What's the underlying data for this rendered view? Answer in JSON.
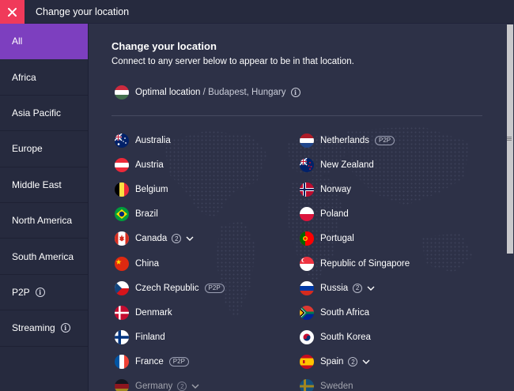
{
  "window": {
    "title": "Change your location"
  },
  "sidebar": {
    "items": [
      {
        "label": "All",
        "active": true
      },
      {
        "label": "Africa"
      },
      {
        "label": "Asia Pacific"
      },
      {
        "label": "Europe"
      },
      {
        "label": "Middle East"
      },
      {
        "label": "North America"
      },
      {
        "label": "South America"
      },
      {
        "label": "P2P",
        "info": true
      },
      {
        "label": "Streaming",
        "info": true
      }
    ]
  },
  "main": {
    "heading": "Change your location",
    "subheading": "Connect to any server below to appear to be in that location.",
    "optimal": {
      "label": "Optimal location",
      "separator": " / ",
      "place": "Budapest, Hungary",
      "flag": "hungary"
    }
  },
  "countries_left": [
    {
      "name": "Australia",
      "flag": "australia"
    },
    {
      "name": "Austria",
      "flag": "austria"
    },
    {
      "name": "Belgium",
      "flag": "belgium"
    },
    {
      "name": "Brazil",
      "flag": "brazil"
    },
    {
      "name": "Canada",
      "flag": "canada",
      "count": "2"
    },
    {
      "name": "China",
      "flag": "china"
    },
    {
      "name": "Czech Republic",
      "flag": "czech",
      "p2p": "P2P"
    },
    {
      "name": "Denmark",
      "flag": "denmark"
    },
    {
      "name": "Finland",
      "flag": "finland"
    },
    {
      "name": "France",
      "flag": "france",
      "p2p": "P2P"
    },
    {
      "name": "Germany",
      "flag": "germany",
      "count": "2"
    }
  ],
  "countries_right": [
    {
      "name": "Netherlands",
      "flag": "netherlands",
      "p2p": "P2P"
    },
    {
      "name": "New Zealand",
      "flag": "newzealand"
    },
    {
      "name": "Norway",
      "flag": "norway"
    },
    {
      "name": "Poland",
      "flag": "poland"
    },
    {
      "name": "Portugal",
      "flag": "portugal"
    },
    {
      "name": "Republic of Singapore",
      "flag": "singapore"
    },
    {
      "name": "Russia",
      "flag": "russia",
      "count": "2"
    },
    {
      "name": "South Africa",
      "flag": "southafrica"
    },
    {
      "name": "South Korea",
      "flag": "southkorea"
    },
    {
      "name": "Spain",
      "flag": "spain",
      "count": "2"
    },
    {
      "name": "Sweden",
      "flag": "sweden"
    }
  ],
  "colors": {
    "accent": "#7d3fbf",
    "close": "#f03a5a",
    "background": "#2d3147",
    "sidebar": "#262a3e"
  }
}
